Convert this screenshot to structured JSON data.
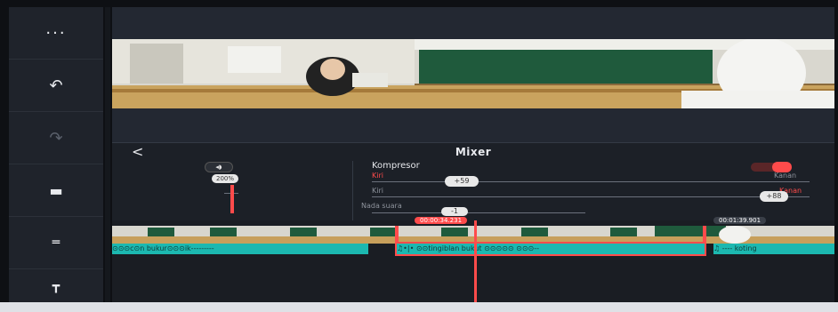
{
  "sidebar": {
    "items": [
      {
        "name": "more-icon",
        "glyph": "···"
      },
      {
        "name": "undo-icon",
        "glyph": "↶"
      },
      {
        "name": "redo-icon",
        "glyph": "↷"
      },
      {
        "name": "crop-icon",
        "glyph": "▬"
      },
      {
        "name": "adjust-icon",
        "glyph": "═"
      },
      {
        "name": "pin-icon",
        "glyph": "┳"
      }
    ]
  },
  "mixer": {
    "back": "<",
    "title": "Mixer",
    "volume_icon": "◂◗",
    "volume_value": "200%",
    "compressor_label": "Kompresor",
    "left_label": "Kiri",
    "right_label": "Kanan",
    "kiri_value": "+59",
    "kanan_value": "+88",
    "pitch_label": "Nada suara",
    "pitch_value": "-1",
    "toggle_on": true
  },
  "timeline": {
    "current_time": "00:00:34.231",
    "end_time": "00:01:39.901",
    "clips": [
      {
        "label": "⊙⊙⊙c⊙n bukur⊙⊙⊙ik---------"
      },
      {
        "label": "♫•|• ⊙⊙tingiblan bukut ⊙⊙⊙⊙⊙ ⊙⊙⊙--"
      },
      {
        "label": "♫ ---- koting"
      }
    ]
  },
  "colors": {
    "accent": "#ff4b4b",
    "clip": "#1cb8b0",
    "panel": "#1c2027"
  }
}
